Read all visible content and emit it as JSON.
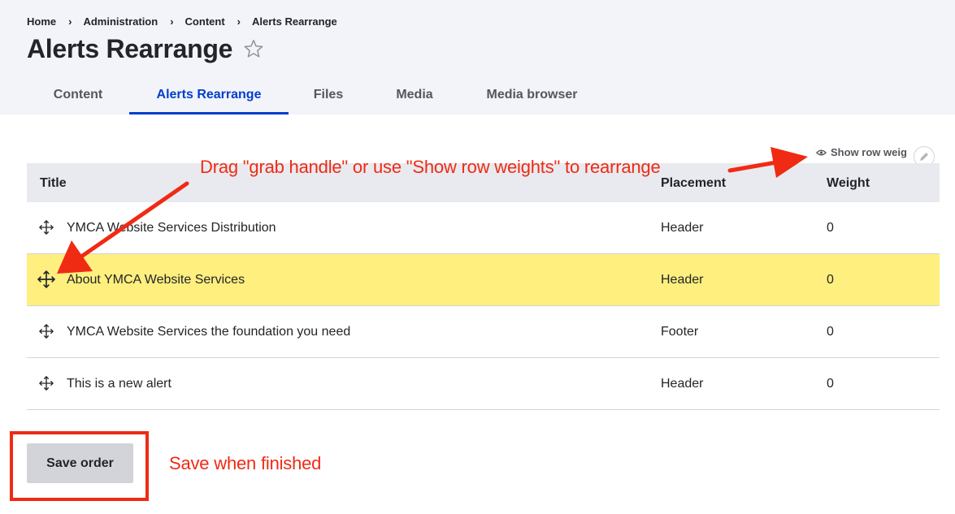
{
  "breadcrumb": {
    "items": [
      "Home",
      "Administration",
      "Content",
      "Alerts Rearrange"
    ],
    "separator": "›"
  },
  "page": {
    "title": "Alerts Rearrange",
    "favorite_icon": "star-outline-icon"
  },
  "tabs": [
    {
      "label": "Content",
      "active": false
    },
    {
      "label": "Alerts Rearrange",
      "active": true
    },
    {
      "label": "Files",
      "active": false
    },
    {
      "label": "Media",
      "active": false
    },
    {
      "label": "Media browser",
      "active": false
    }
  ],
  "table": {
    "show_weights_label": "Show row weig",
    "show_weights_icon": "eye-icon",
    "edit_icon": "pencil-icon",
    "columns": [
      "Title",
      "Placement",
      "Weight"
    ],
    "rows": [
      {
        "title": "YMCA Website Services Distribution",
        "placement": "Header",
        "weight": "0",
        "highlighted": false
      },
      {
        "title": "About YMCA Website Services",
        "placement": "Header",
        "weight": "0",
        "highlighted": true
      },
      {
        "title": "YMCA Website Services the foundation you need",
        "placement": "Footer",
        "weight": "0",
        "highlighted": false
      },
      {
        "title": "This is a new alert",
        "placement": "Header",
        "weight": "0",
        "highlighted": false
      }
    ],
    "drag_handle_icon": "move-handle-icon"
  },
  "actions": {
    "save_label": "Save order"
  },
  "annotations": {
    "drag_hint": "Drag \"grab handle\" or use \"Show row weights\" to rearrange",
    "save_hint": "Save when finished",
    "color": "#ef2b14"
  },
  "colors": {
    "accent": "#003ecc",
    "header_bg": "#f3f4f9",
    "highlight_row": "#feef7e",
    "table_header_bg": "#e9eaef"
  }
}
